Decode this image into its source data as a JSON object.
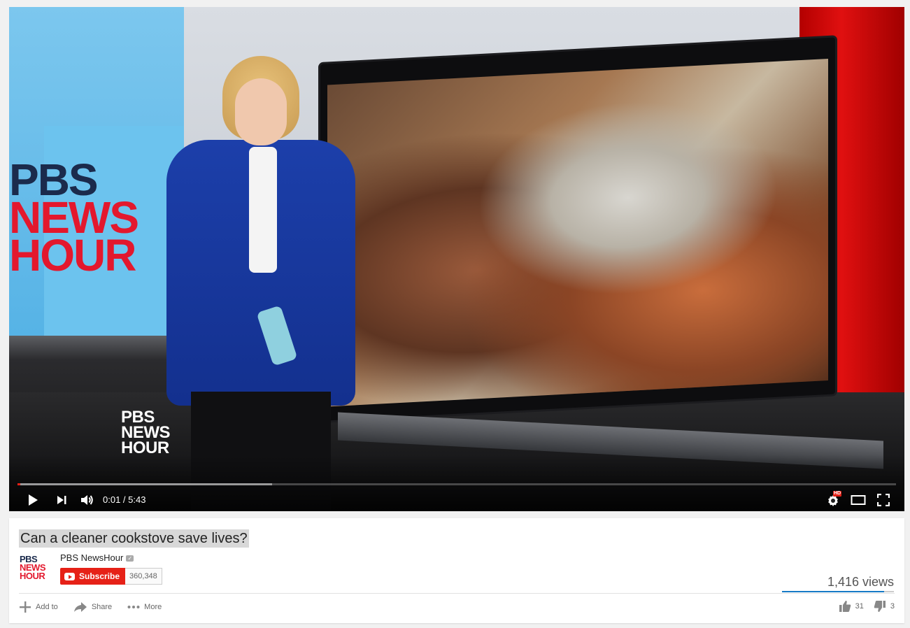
{
  "player": {
    "studio_logo": [
      "PBS",
      "NEWS",
      "HOUR"
    ],
    "bug_logo": [
      "PBS",
      "NEWS",
      "HOUR"
    ],
    "current_time": "0:01",
    "duration": "5:43",
    "time_display": "0:01 / 5:43",
    "progress_played_fraction": 0.003,
    "progress_loaded_fraction": 0.29,
    "controls": {
      "play_icon": "play-icon",
      "next_icon": "next-icon",
      "volume_icon": "volume-icon",
      "settings_icon": "gear-icon",
      "hd_badge": "HD",
      "theater_icon": "theater-mode-icon",
      "fullscreen_icon": "fullscreen-icon"
    },
    "colors": {
      "progress_red": "#e52117"
    }
  },
  "video": {
    "title": "Can a cleaner cookstove save lives?",
    "channel": {
      "name": "PBS NewsHour",
      "avatar_text": [
        "PBS",
        "NEWS",
        "HOUR"
      ],
      "verified": true
    },
    "subscribe": {
      "label": "Subscribe",
      "count": "360,348"
    },
    "views": "1,416 views",
    "like_fraction": 0.91,
    "actions": {
      "add_to": "Add to",
      "share": "Share",
      "more": "More"
    },
    "likes": "31",
    "dislikes": "3",
    "colors": {
      "subscribe_red": "#e62117",
      "like_bar_blue": "#167ac6"
    }
  }
}
